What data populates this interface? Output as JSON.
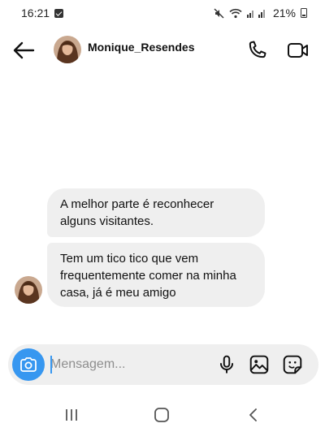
{
  "status_bar": {
    "time": "16:21",
    "battery": "21%",
    "icons": [
      "notification-icon",
      "mute-icon",
      "wifi-icon",
      "signal-icon",
      "battery-icon"
    ]
  },
  "header": {
    "contact_name": "Monique_Resendes",
    "icons": [
      "back-arrow-icon",
      "avatar",
      "phone-icon",
      "video-camera-icon"
    ]
  },
  "messages": [
    {
      "text": "A melhor parte é reconhecer alguns visitantes.",
      "direction": "incoming"
    },
    {
      "text": "Tem um tico tico que vem frequentemente comer na minha casa, já é meu amigo",
      "direction": "incoming"
    }
  ],
  "composer": {
    "placeholder": "Mensagem...",
    "value": "",
    "icons": [
      "camera-icon",
      "microphone-icon",
      "gallery-icon",
      "sticker-icon"
    ]
  },
  "nav_bar": {
    "icons": [
      "recents-icon",
      "home-icon",
      "back-icon"
    ]
  },
  "colors": {
    "accent": "#3797f0",
    "bubble": "#efefef",
    "background": "#ffffff"
  }
}
